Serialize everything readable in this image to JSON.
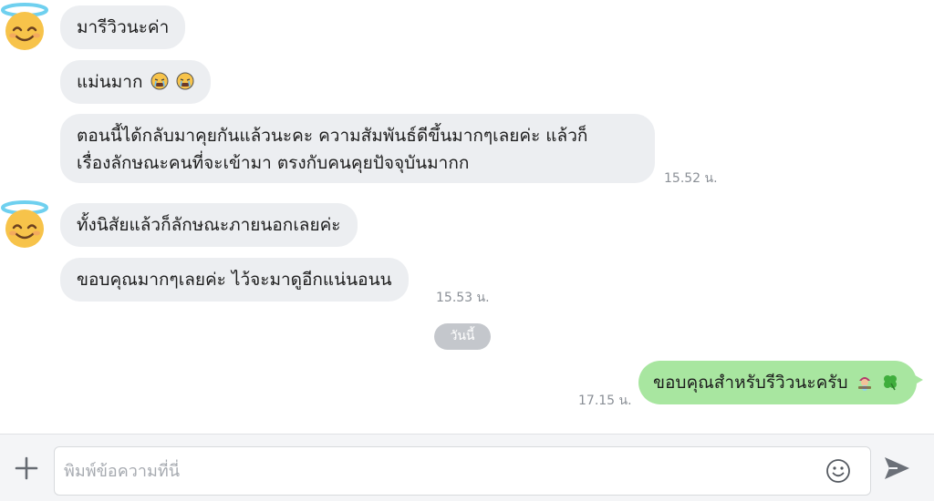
{
  "messages": [
    {
      "text": "มารีวิวนะค่า"
    },
    {
      "text": "แม่นมาก"
    },
    {
      "lines": [
        "ตอนนี้ได้กลับมาคุยกันแล้วนะคะ ความสัมพันธ์ดีขึ้นมากๆเลยค่ะ แล้วก็",
        "เรื่องลักษณะคนที่จะเข้ามา ตรงกับคนคุยปัจจุบันมากก"
      ],
      "time": "15.52 น."
    },
    {
      "text": "ทั้งนิสัยแล้วก็ลักษณะภายนอกเลยค่ะ"
    },
    {
      "text": "ขอบคุณมากๆเลยค่ะ ไว้จะมาดูอีกแน่นอนน",
      "time": "15.53 น."
    }
  ],
  "date_divider": "วันนี้",
  "my_message": {
    "text": "ขอบคุณสำหรับรีวิวนะครับ",
    "time": "17.15 น.",
    "bubble_color": "#a8e6a0"
  },
  "composer": {
    "placeholder": "พิมพ์ข้อความที่นี่"
  },
  "icons": {
    "avatar": "smiling-face-with-halo",
    "emoji_crying": "loudly-crying-face",
    "emoji_fortune": "fortune-teller",
    "emoji_clover": "four-leaf-clover",
    "plus": "plus-icon",
    "smile": "smile-icon",
    "send": "send-icon"
  },
  "colors": {
    "incoming_bubble": "#eceef1",
    "outgoing_bubble": "#a8e6a0",
    "date_pill": "#c4c7cc"
  }
}
